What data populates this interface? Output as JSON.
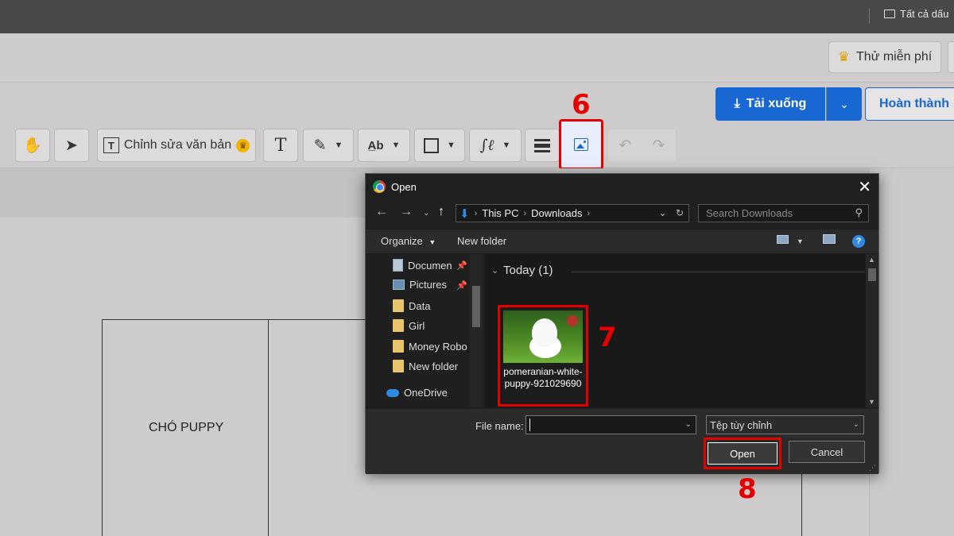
{
  "browser": {
    "bookmark_label": "Tất cả dấu"
  },
  "header": {
    "trial_label": "Thử miễn phí"
  },
  "actions": {
    "download_label": "Tải xuống",
    "done_label": "Hoàn thành"
  },
  "toolbar": {
    "edit_text_label": "Chỉnh sửa văn bản"
  },
  "steps": {
    "step6": "6",
    "step7": "7",
    "step8": "8"
  },
  "document": {
    "cell_text": "CHÓ PUPPY"
  },
  "dialog": {
    "title": "Open",
    "breadcrumb": [
      "This PC",
      "Downloads"
    ],
    "search_placeholder": "Search Downloads",
    "organize_label": "Organize",
    "new_folder_label": "New folder",
    "nav_items": [
      {
        "label": "Documen",
        "icon": "document-icon",
        "pinned": true
      },
      {
        "label": "Pictures",
        "icon": "pictures-icon",
        "pinned": true
      },
      {
        "label": "Data",
        "icon": "folder-icon",
        "pinned": false
      },
      {
        "label": "Girl",
        "icon": "folder-icon",
        "pinned": false
      },
      {
        "label": "Money Robo",
        "icon": "folder-icon",
        "pinned": false
      },
      {
        "label": "New folder",
        "icon": "folder-icon",
        "pinned": false
      },
      {
        "label": "OneDrive",
        "icon": "cloud-icon",
        "pinned": false
      }
    ],
    "group_header": "Today (1)",
    "file": {
      "name": "pomeranian-white-puppy-921029690"
    },
    "file_name_label": "File name:",
    "file_name_value": "",
    "filter_value": "Tệp tùy chỉnh",
    "open_label": "Open",
    "cancel_label": "Cancel"
  },
  "colors": {
    "accent_blue": "#1967d2",
    "highlight_red": "#e50000",
    "dialog_bg": "#202020"
  }
}
